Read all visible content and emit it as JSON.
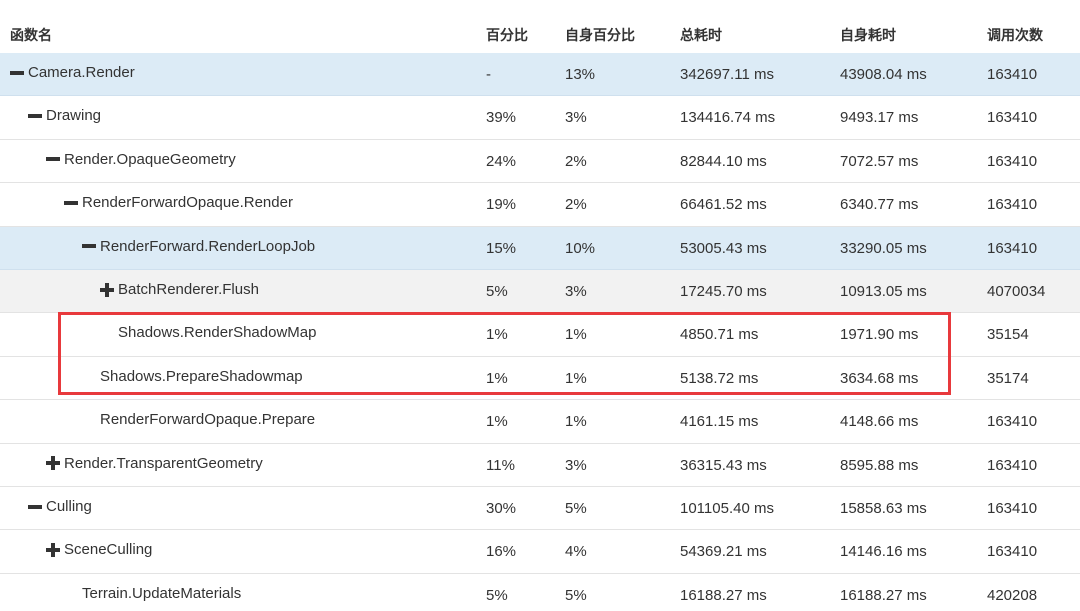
{
  "columns": {
    "name": "函数名",
    "pct": "百分比",
    "self_pct": "自身百分比",
    "total": "总耗时",
    "self": "自身耗时",
    "calls": "调用次数"
  },
  "rows": [
    {
      "name": "Camera.Render",
      "depth": 0,
      "toggle": "collapse",
      "state": "selected",
      "pct": "-",
      "self_pct": "13%",
      "total": "342697.11 ms",
      "self": "43908.04 ms",
      "calls": "163410"
    },
    {
      "name": "Drawing",
      "depth": 1,
      "toggle": "collapse",
      "state": "",
      "pct": "39%",
      "self_pct": "3%",
      "total": "134416.74 ms",
      "self": "9493.17 ms",
      "calls": "163410"
    },
    {
      "name": "Render.OpaqueGeometry",
      "depth": 2,
      "toggle": "collapse",
      "state": "",
      "pct": "24%",
      "self_pct": "2%",
      "total": "82844.10 ms",
      "self": "7072.57 ms",
      "calls": "163410"
    },
    {
      "name": "RenderForwardOpaque.Render",
      "depth": 3,
      "toggle": "collapse",
      "state": "",
      "pct": "19%",
      "self_pct": "2%",
      "total": "66461.52 ms",
      "self": "6340.77 ms",
      "calls": "163410"
    },
    {
      "name": "RenderForward.RenderLoopJob",
      "depth": 4,
      "toggle": "collapse",
      "state": "selected",
      "pct": "15%",
      "self_pct": "10%",
      "total": "53005.43 ms",
      "self": "33290.05 ms",
      "calls": "163410"
    },
    {
      "name": "BatchRenderer.Flush",
      "depth": 5,
      "toggle": "expand",
      "state": "hover",
      "pct": "5%",
      "self_pct": "3%",
      "total": "17245.70 ms",
      "self": "10913.05 ms",
      "calls": "4070034"
    },
    {
      "name": "Shadows.RenderShadowMap",
      "depth": 5,
      "toggle": "none",
      "state": "",
      "pct": "1%",
      "self_pct": "1%",
      "total": "4850.71 ms",
      "self": "1971.90 ms",
      "calls": "35154"
    },
    {
      "name": "Shadows.PrepareShadowmap",
      "depth": 4,
      "toggle": "none",
      "state": "",
      "pct": "1%",
      "self_pct": "1%",
      "total": "5138.72 ms",
      "self": "3634.68 ms",
      "calls": "35174"
    },
    {
      "name": "RenderForwardOpaque.Prepare",
      "depth": 4,
      "toggle": "none",
      "state": "",
      "pct": "1%",
      "self_pct": "1%",
      "total": "4161.15 ms",
      "self": "4148.66 ms",
      "calls": "163410"
    },
    {
      "name": "Render.TransparentGeometry",
      "depth": 2,
      "toggle": "expand",
      "state": "",
      "pct": "11%",
      "self_pct": "3%",
      "total": "36315.43 ms",
      "self": "8595.88 ms",
      "calls": "163410"
    },
    {
      "name": "Culling",
      "depth": 1,
      "toggle": "collapse",
      "state": "",
      "pct": "30%",
      "self_pct": "5%",
      "total": "101105.40 ms",
      "self": "15858.63 ms",
      "calls": "163410"
    },
    {
      "name": "SceneCulling",
      "depth": 2,
      "toggle": "expand",
      "state": "",
      "pct": "16%",
      "self_pct": "4%",
      "total": "54369.21 ms",
      "self": "14146.16 ms",
      "calls": "163410"
    },
    {
      "name": "Terrain.UpdateMaterials",
      "depth": 3,
      "toggle": "none",
      "state": "",
      "pct": "5%",
      "self_pct": "5%",
      "total": "16188.27 ms",
      "self": "16188.27 ms",
      "calls": "420208"
    }
  ],
  "highlight_color": "#e8393c",
  "selected_row_color": "#dcebf6"
}
